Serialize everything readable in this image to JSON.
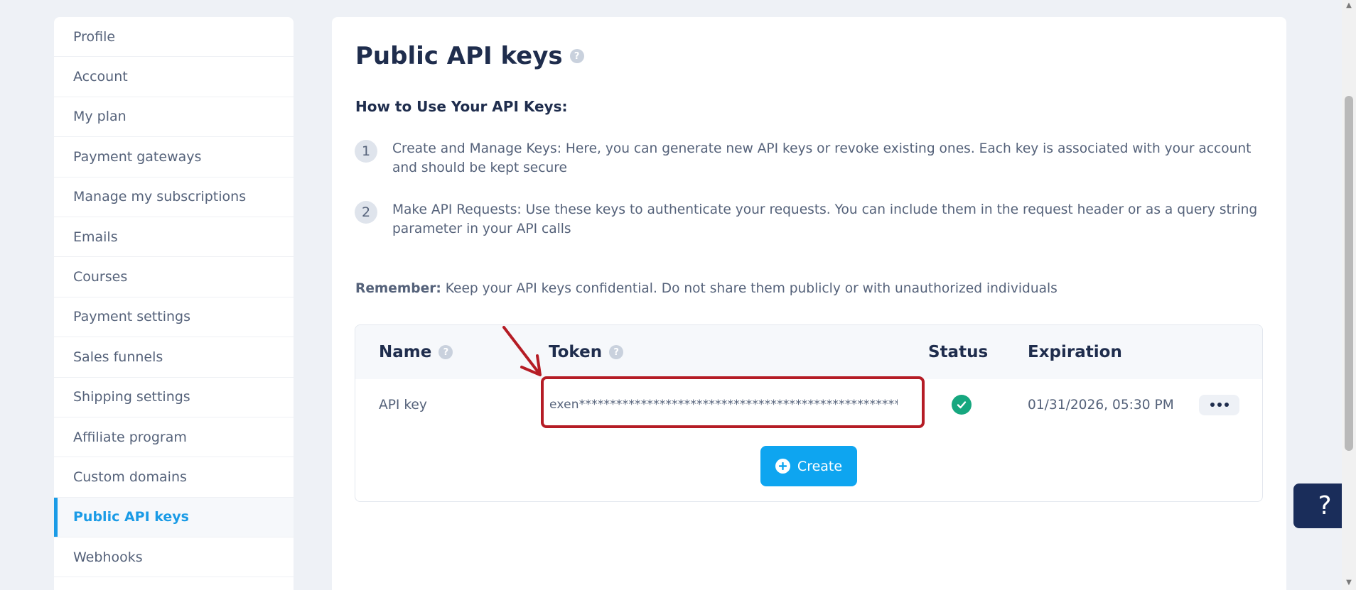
{
  "sidebar": {
    "items": [
      {
        "label": "Profile"
      },
      {
        "label": "Account"
      },
      {
        "label": "My plan"
      },
      {
        "label": "Payment gateways"
      },
      {
        "label": "Manage my subscriptions"
      },
      {
        "label": "Emails"
      },
      {
        "label": "Courses"
      },
      {
        "label": "Payment settings"
      },
      {
        "label": "Sales funnels"
      },
      {
        "label": "Shipping settings"
      },
      {
        "label": "Affiliate program"
      },
      {
        "label": "Custom domains"
      },
      {
        "label": "Public API keys",
        "active": true
      },
      {
        "label": "Webhooks"
      }
    ]
  },
  "main": {
    "title": "Public API keys",
    "help_glyph": "?",
    "howto_heading": "How to Use Your API Keys:",
    "steps": [
      {
        "num": "1",
        "text": "Create and Manage Keys: Here, you can generate new API keys or revoke existing ones. Each key is associated with your account and should be kept secure"
      },
      {
        "num": "2",
        "text": "Make API Requests: Use these keys to authenticate your requests. You can include them in the request header or as a query string parameter in your API calls"
      }
    ],
    "remember_label": "Remember:",
    "remember_text": "Keep your API keys confidential. Do not share them publicly or with unauthorized individuals"
  },
  "table": {
    "headers": {
      "name": "Name",
      "token": "Token",
      "status": "Status",
      "expiration": "Expiration"
    },
    "rows": [
      {
        "name": "API key",
        "token": "exen*****************************************************…",
        "status": "active",
        "expiration": "01/31/2026, 05:30 PM"
      }
    ]
  },
  "create_button": {
    "label": "Create"
  },
  "help_widget": {
    "glyph": "?"
  },
  "colors": {
    "accent": "#1a9be6",
    "button": "#0ea5f0",
    "status_ok": "#16a77f",
    "annotation": "#b51c25",
    "help_widget": "#1a2d5a"
  }
}
